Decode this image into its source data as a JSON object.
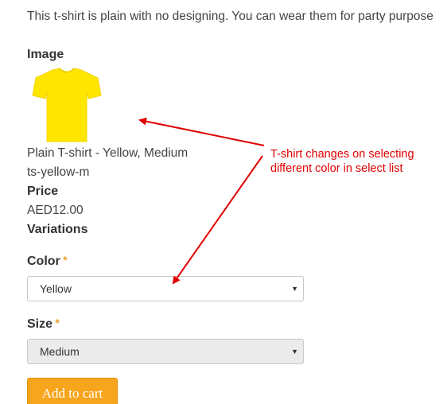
{
  "product": {
    "description": "This t-shirt is plain with no designing. You can wear them for party purpose",
    "image_heading": "Image",
    "name": "Plain T-shirt - Yellow, Medium",
    "sku": "ts-yellow-m",
    "price_heading": "Price",
    "price": "AED12.00",
    "variations_heading": "Variations"
  },
  "form": {
    "color_label": "Color",
    "color_value": "Yellow",
    "size_label": "Size",
    "size_value": "Medium",
    "required_marker": "*",
    "add_to_cart": "Add to cart"
  },
  "annotation": {
    "line1": "T-shirt changes on selecting",
    "line2": "different color in select list"
  },
  "colors": {
    "tshirt": "#ffe600",
    "button": "#f7a51c",
    "annotation": "#e00000"
  },
  "icons": {
    "select_caret": "▼"
  }
}
